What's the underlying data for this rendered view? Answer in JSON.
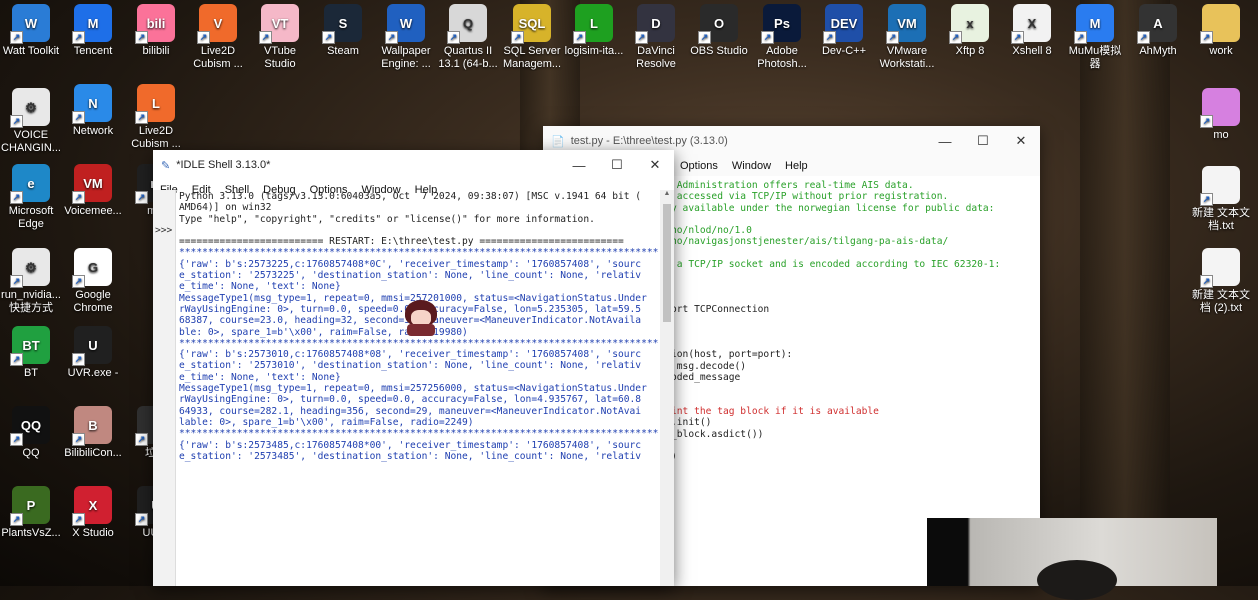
{
  "desktop": {
    "icons": [
      {
        "label": "Watt Toolkit",
        "color": "#2a7cd6",
        "glyph": "W"
      },
      {
        "label": "Tencent",
        "color": "#1e6fe8",
        "glyph": "M"
      },
      {
        "label": "bilibili",
        "color": "#fb7299",
        "glyph": "bili"
      },
      {
        "label": "Live2D Cubism ...",
        "color": "#f06a2b",
        "glyph": "V"
      },
      {
        "label": "VTube Studio",
        "color": "#f5b8c8",
        "glyph": "VT"
      },
      {
        "label": "Steam",
        "color": "#1b2838",
        "glyph": "S"
      },
      {
        "label": "Wallpaper Engine: ...",
        "color": "#2060c0",
        "glyph": "W"
      },
      {
        "label": "Quartus II 13.1 (64-b...",
        "color": "#d8d8d8",
        "glyph": "Q"
      },
      {
        "label": "SQL Server Managem...",
        "color": "#d7b32a",
        "glyph": "SQL"
      },
      {
        "label": "logisim-ita...",
        "color": "#1ea020",
        "glyph": "L"
      },
      {
        "label": "DaVinci Resolve",
        "color": "#333340",
        "glyph": "D"
      },
      {
        "label": "OBS Studio",
        "color": "#2a2a2a",
        "glyph": "O"
      },
      {
        "label": "Adobe Photosh...",
        "color": "#0a1a3a",
        "glyph": "Ps"
      },
      {
        "label": "Dev-C++",
        "color": "#1f4fa8",
        "glyph": "DEV"
      },
      {
        "label": "VMware Workstati...",
        "color": "#1c6fb5",
        "glyph": "VM"
      },
      {
        "label": "Xftp 8",
        "color": "#e8f2e0",
        "glyph": "x"
      },
      {
        "label": "Xshell 8",
        "color": "#f2f2f2",
        "glyph": "X"
      },
      {
        "label": "MuMu模拟器",
        "color": "#2a7cf0",
        "glyph": "M"
      },
      {
        "label": "AhMyth",
        "color": "#333",
        "glyph": "A"
      },
      {
        "label": "work",
        "color": "#e8c25a",
        "glyph": ""
      },
      {
        "label": "VOICE CHANGIN...",
        "color": "#e8e8e8",
        "glyph": "⚙"
      },
      {
        "label": "Network",
        "color": "#2a8ae8",
        "glyph": "N"
      },
      {
        "label": "Live2D Cubism ...",
        "color": "#f06a2b",
        "glyph": "L"
      },
      {
        "label": "mo",
        "color": "#d680e0",
        "glyph": ""
      },
      {
        "label": "Microsoft Edge",
        "color": "#1e88c8",
        "glyph": "e"
      },
      {
        "label": "Voicemee...",
        "color": "#c02020",
        "glyph": "VM"
      },
      {
        "label": "min",
        "color": "#202020",
        "glyph": "m"
      },
      {
        "label": "新建 文本文档.txt",
        "color": "#f4f4f4",
        "glyph": ""
      },
      {
        "label": "run_nvidia... 快捷方式",
        "color": "#e8e8e8",
        "glyph": "⚙"
      },
      {
        "label": "Google Chrome",
        "color": "#ffffff",
        "glyph": "G"
      },
      {
        "label": "新建 文本文档 (2).txt",
        "color": "#f4f4f4",
        "glyph": ""
      },
      {
        "label": "BT",
        "color": "#20a040",
        "glyph": "BT"
      },
      {
        "label": "UVR.exe -",
        "color": "#202020",
        "glyph": "U"
      },
      {
        "label": "QQ",
        "color": "#111",
        "glyph": "QQ"
      },
      {
        "label": "BilibiliCon...",
        "color": "#c08880",
        "glyph": "B"
      },
      {
        "label": "垃圾",
        "color": "#303030",
        "glyph": ""
      },
      {
        "label": "PlantsVsZ...",
        "color": "#3a6a20",
        "glyph": "P"
      },
      {
        "label": "X Studio",
        "color": "#d02030",
        "glyph": "X"
      },
      {
        "label": "UU加",
        "color": "#202020",
        "glyph": "U"
      }
    ]
  },
  "editor": {
    "title": "test.py - E:\\three\\test.py (3.13.0)",
    "menus": [
      "Options",
      "Window",
      "Help"
    ],
    "lines": [
      {
        "text": " Administration offers real-time AIS data.",
        "color": "#2aa12a"
      },
      {
        "text": " accessed via TCP/IP without prior registration.",
        "color": "#2aa12a"
      },
      {
        "text": "y available under the norwegian license for public data:",
        "color": "#2aa12a"
      },
      {
        "text": "",
        "color": "#000"
      },
      {
        "text": "no/nlod/no/1.0",
        "color": "#2aa12a"
      },
      {
        "text": "no/navigasjonstjenester/ais/tilgang-pa-ais-data/",
        "color": "#2aa12a"
      },
      {
        "text": "",
        "color": "#000"
      },
      {
        "text": " a TCP/IP socket and is encoded according to IEC 62320-1:",
        "color": "#2aa12a"
      },
      {
        "text": "",
        "color": "#000"
      },
      {
        "text": "",
        "color": "#000"
      },
      {
        "text": "",
        "color": "#000"
      },
      {
        "text": "ort TCPConnection",
        "color": "#222"
      },
      {
        "text": "",
        "color": "#000"
      },
      {
        "text": "",
        "color": "#000"
      },
      {
        "text": "",
        "color": "#000"
      },
      {
        "text": "ion(host, port=port):",
        "color": "#222"
      },
      {
        "text": " msg.decode()",
        "color": "#222"
      },
      {
        "text": "oded_message",
        "color": "#222"
      },
      {
        "text": "",
        "color": "#000"
      },
      {
        "text": "",
        "color": "#000"
      },
      {
        "text": "int the tag block if it is available",
        "color": "#d03030"
      },
      {
        "text": ".init()",
        "color": "#222"
      },
      {
        "text": "_block.asdict())",
        "color": "#222"
      },
      {
        "text": "",
        "color": "#000"
      },
      {
        "text": ")",
        "color": "#222"
      }
    ]
  },
  "shell": {
    "title": "*IDLE Shell 3.13.0*",
    "menus": [
      "File",
      "Edit",
      "Shell",
      "Debug",
      "Options",
      "Window",
      "Help"
    ],
    "prompt": ">>>",
    "lines": [
      {
        "text": "Python 3.13.0 (tags/v3.13.0:60403a5, Oct  7 2024, 09:38:07) [MSC v.1941 64 bit (",
        "color": "#222"
      },
      {
        "text": "AMD64)] on win32",
        "color": "#222"
      },
      {
        "text": "Type \"help\", \"copyright\", \"credits\" or \"license()\" for more information.",
        "color": "#222"
      },
      {
        "text": "",
        "color": "#222"
      },
      {
        "text": "========================= RESTART: E:\\three\\test.py =========================",
        "color": "#222"
      },
      {
        "text": "************************************************************************************",
        "color": "#1f3fb0"
      },
      {
        "text": "{'raw': b's:2573225,c:1760857408*0C', 'receiver_timestamp': '1760857408', 'sourc",
        "color": "#1f3fb0"
      },
      {
        "text": "e_station': '2573225', 'destination_station': None, 'line_count': None, 'relativ",
        "color": "#1f3fb0"
      },
      {
        "text": "e_time': None, 'text': None}",
        "color": "#1f3fb0"
      },
      {
        "text": "MessageType1(msg_type=1, repeat=0, mmsi=257201000, status=<NavigationStatus.Under",
        "color": "#1f3fb0"
      },
      {
        "text": "rWayUsingEngine: 0>, turn=0.0, speed=0.0, accuracy=False, lon=5.235305, lat=59.5",
        "color": "#1f3fb0"
      },
      {
        "text": "68387, course=23.0, heading=32, second=35, maneuver=<ManeuverIndicator.NotAvaila",
        "color": "#1f3fb0"
      },
      {
        "text": "ble: 0>, spare_1=b'\\x00', raim=False, radio=19980)",
        "color": "#1f3fb0"
      },
      {
        "text": "************************************************************************************",
        "color": "#1f3fb0"
      },
      {
        "text": "{'raw': b's:2573010,c:1760857408*08', 'receiver_timestamp': '1760857408', 'sourc",
        "color": "#1f3fb0"
      },
      {
        "text": "e_station': '2573010', 'destination_station': None, 'line_count': None, 'relativ",
        "color": "#1f3fb0"
      },
      {
        "text": "e_time': None, 'text': None}",
        "color": "#1f3fb0"
      },
      {
        "text": "MessageType1(msg_type=1, repeat=0, mmsi=257256000, status=<NavigationStatus.Under",
        "color": "#1f3fb0"
      },
      {
        "text": "rWayUsingEngine: 0>, turn=0.0, speed=0.0, accuracy=False, lon=4.935767, lat=60.8",
        "color": "#1f3fb0"
      },
      {
        "text": "64933, course=282.1, heading=356, second=29, maneuver=<ManeuverIndicator.NotAvai",
        "color": "#1f3fb0"
      },
      {
        "text": "lable: 0>, spare_1=b'\\x00', raim=False, radio=2249)",
        "color": "#1f3fb0"
      },
      {
        "text": "************************************************************************************",
        "color": "#1f3fb0"
      },
      {
        "text": "{'raw': b's:2573485,c:1760857408*00', 'receiver_timestamp': '1760857408', 'sourc",
        "color": "#1f3fb0"
      },
      {
        "text": "e_station': '2573485', 'destination_station': None, 'line_count': None, 'relativ",
        "color": "#1f3fb0"
      }
    ]
  }
}
